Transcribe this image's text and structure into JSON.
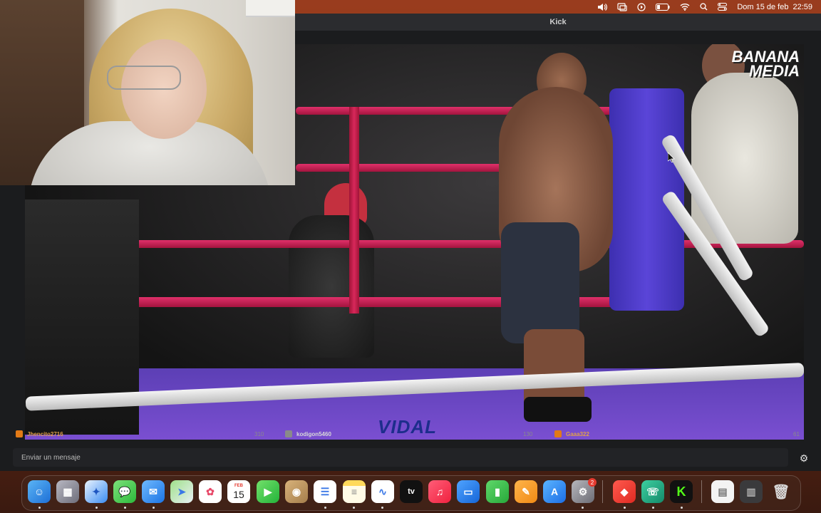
{
  "menubar": {
    "icons": [
      "sound-icon",
      "screen-mirror-icon",
      "play-icon",
      "battery-icon",
      "wifi-icon",
      "search-icon",
      "control-center-icon"
    ],
    "date": "Dom 15 de feb",
    "time": "22:59"
  },
  "window": {
    "title": "Kick"
  },
  "video": {
    "channel_logo_line1": "BANANA",
    "channel_logo_line2": "MEDIA",
    "watermark": "VIDAL"
  },
  "chat": {
    "supporters": [
      {
        "name": "Jhencito2716",
        "count": "310",
        "badge": "orange"
      },
      {
        "name": "kodigon5460",
        "count": "130",
        "badge": "gray"
      },
      {
        "name": "Gaaa322",
        "count": "61",
        "badge": "orange"
      }
    ],
    "input_placeholder": "Enviar un mensaje"
  },
  "dock": {
    "calendar_month": "FEB",
    "calendar_day": "15",
    "appstore_badge": "2",
    "apps": [
      "finder",
      "launchpad",
      "safari",
      "messages",
      "mail",
      "maps",
      "photos",
      "calendar",
      "facetime",
      "contacts",
      "reminders",
      "notes",
      "freeform",
      "tv",
      "music",
      "keynote",
      "numbers",
      "pages",
      "app-store",
      "system-settings",
      "anydesk",
      "support",
      "kick",
      "preview",
      "screenshot",
      "trash"
    ]
  },
  "colors": {
    "accent": "#e27a16",
    "rope": "#d8285a",
    "kick_green": "#53fc18"
  }
}
